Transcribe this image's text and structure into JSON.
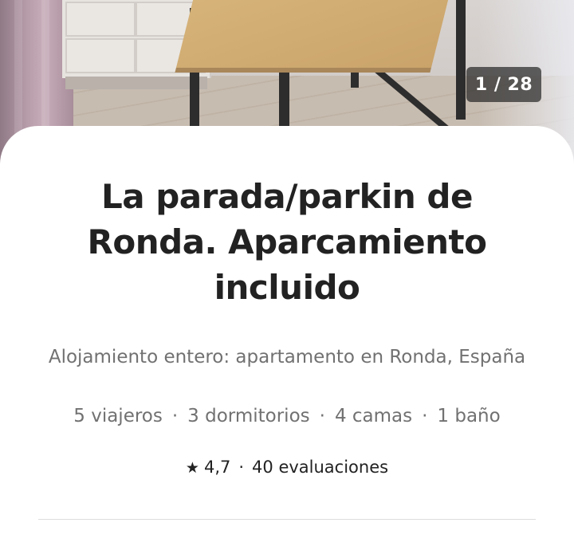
{
  "photo": {
    "counter": "1 / 28"
  },
  "listing": {
    "title": "La parada/parkin de Ronda. Aparcamiento incluido",
    "subtitle": "Alojamiento entero: apartamento en Ronda, España",
    "details": {
      "guests": "5 viajeros",
      "bedrooms": "3 dormitorios",
      "beds": "4 camas",
      "baths": "1 baño",
      "separator": "·"
    },
    "rating": {
      "icon": "star-icon",
      "score": "4,7",
      "separator": "·",
      "reviews": "40 evaluaciones"
    }
  }
}
